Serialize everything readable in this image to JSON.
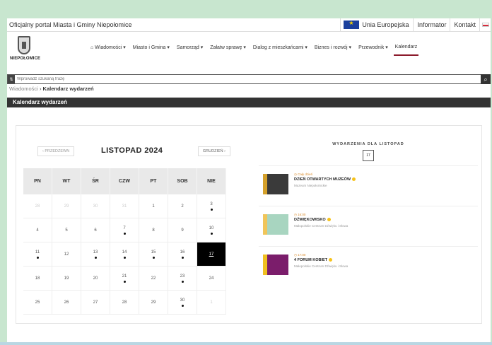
{
  "topbar": {
    "portal_title": "Oficjalny portal Miasta i Gminy Niepołomice",
    "eu_label": "Unia Europejska",
    "links": [
      "Informator",
      "Kontakt"
    ]
  },
  "header": {
    "logo_text": "NIEPOŁOMICE",
    "nav": [
      "⌂ Wiadomości ▾",
      "Miasto i Gmina ▾",
      "Samorząd ▾",
      "Załatw sprawę ▾",
      "Dialog z mieszkańcami ▾",
      "Biznes i rozwój ▾",
      "Przewodnik ▾",
      "Kalendarz"
    ]
  },
  "search": {
    "placeholder": "Wprowadź szukaną frazę"
  },
  "breadcrumb": {
    "link": "Wiadomości",
    "separator": "›",
    "current": "Kalendarz wydarzeń"
  },
  "section_title": "Kalendarz wydarzeń",
  "calendar": {
    "prev_label": "‹ PRZEDZEWN",
    "month_label": "LISTOPAD 2024",
    "next_label": "GRUDZIEŃ ›",
    "weekdays": [
      "PN",
      "WT",
      "ŚR",
      "CZW",
      "PT",
      "SOB",
      "NIE"
    ],
    "weeks": [
      [
        {
          "d": "28",
          "other": true
        },
        {
          "d": "29",
          "other": true
        },
        {
          "d": "30",
          "other": true
        },
        {
          "d": "31",
          "other": true
        },
        {
          "d": "1"
        },
        {
          "d": "2"
        },
        {
          "d": "3",
          "dot": true
        }
      ],
      [
        {
          "d": "4"
        },
        {
          "d": "5"
        },
        {
          "d": "6"
        },
        {
          "d": "7",
          "dot": true
        },
        {
          "d": "8"
        },
        {
          "d": "9"
        },
        {
          "d": "10",
          "dot": true
        }
      ],
      [
        {
          "d": "11",
          "dot": true
        },
        {
          "d": "12"
        },
        {
          "d": "13",
          "dot": true
        },
        {
          "d": "14",
          "dot": true
        },
        {
          "d": "15",
          "dot": true
        },
        {
          "d": "16",
          "dot": true
        },
        {
          "d": "17",
          "today": true
        }
      ],
      [
        {
          "d": "18"
        },
        {
          "d": "19"
        },
        {
          "d": "20"
        },
        {
          "d": "21",
          "dot": true
        },
        {
          "d": "22"
        },
        {
          "d": "23",
          "dot": true
        },
        {
          "d": "24"
        }
      ],
      [
        {
          "d": "25"
        },
        {
          "d": "26"
        },
        {
          "d": "27"
        },
        {
          "d": "28"
        },
        {
          "d": "29"
        },
        {
          "d": "30",
          "dot": true
        },
        {
          "d": "1",
          "other": true
        }
      ]
    ]
  },
  "events": {
    "title": "WYDARZENIA DLA LISTOPAD",
    "day": "17",
    "items": [
      {
        "time": "◷ Cały dzień",
        "title": "DZIEŃ OTWARTYCH MUZEÓW",
        "place": "Muzeum Niepołomickie",
        "thumb_color": "#3a3a3a",
        "accent": "#d4a02a"
      },
      {
        "time": "◷ 16:00",
        "title": "DŹWIĘKOWISKO",
        "place": "Małopolskie Centrum Dźwięku i Słowa",
        "thumb_color": "#a8d5c0",
        "accent": "#f0c55a"
      },
      {
        "time": "◷ 17:00",
        "title": "4 FORUM KOBIET",
        "place": "Małopolskie Centrum Dźwięku i Słowa",
        "thumb_color": "#7b1d6b",
        "accent": "#f0c020"
      }
    ]
  }
}
